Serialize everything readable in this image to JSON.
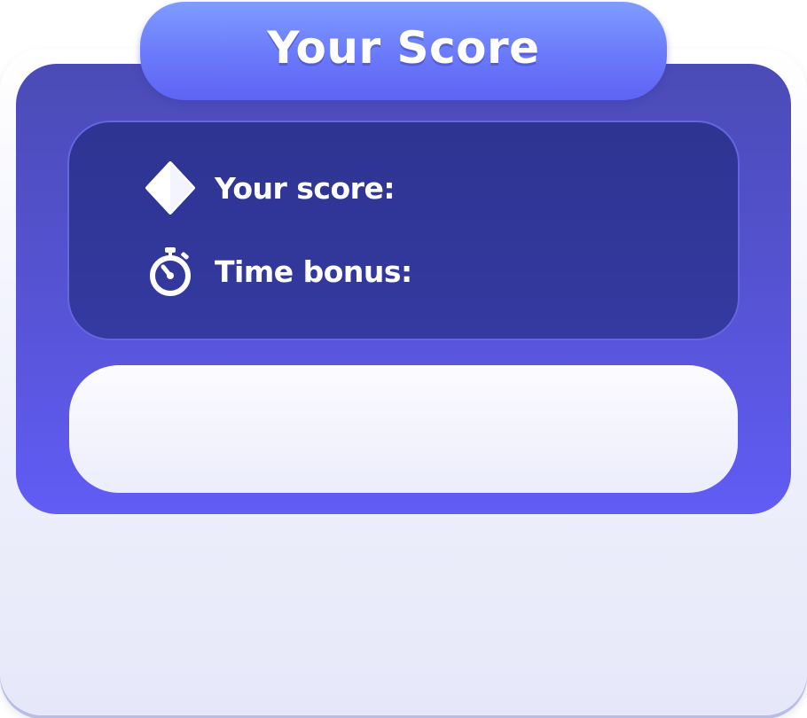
{
  "title": "Your Score",
  "stats": {
    "score": {
      "label": "Your score:",
      "icon": "diamond-icon"
    },
    "time_bonus": {
      "label": "Time bonus:",
      "icon": "stopwatch-icon"
    }
  },
  "colors": {
    "title_pill": "#6a79fb",
    "panel": "#5552d0",
    "stats_box": "#2f3696",
    "text": "#ffffff"
  }
}
